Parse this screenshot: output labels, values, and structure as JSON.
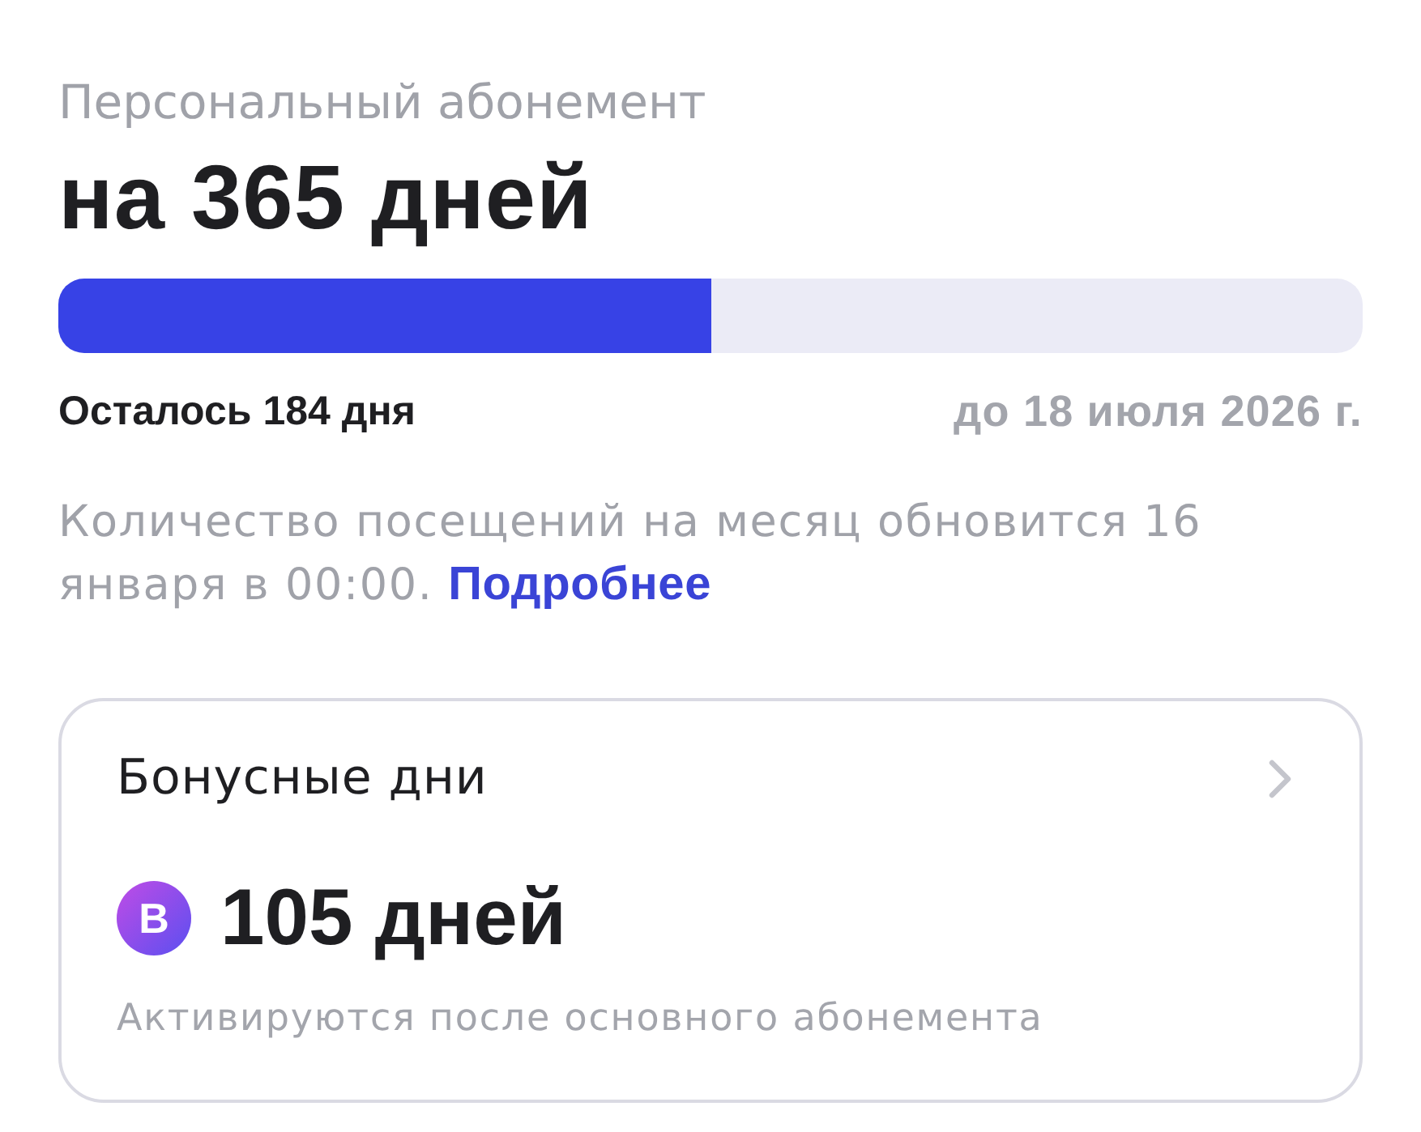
{
  "subscription": {
    "label": "Персональный абонемент",
    "title": "на 365 дней",
    "progress": {
      "level": 0.5
    },
    "remaining": "Осталось 184 дня",
    "until": "до 18 июля 2026 г."
  },
  "notice": {
    "text": "Количество посещений на месяц обновится 16 января в 00:00.",
    "link": "Подробнее"
  },
  "bonus_card": {
    "title": "Бонусные дни",
    "badge": "B",
    "amount": "105 дней",
    "note": "Активируются после основного абонемента"
  }
}
